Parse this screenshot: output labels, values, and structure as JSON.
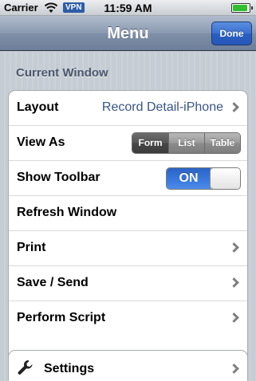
{
  "status": {
    "carrier": "Carrier",
    "vpn": "VPN",
    "time": "11:59 AM",
    "battery_level": 0.9
  },
  "nav": {
    "title": "Menu",
    "done_label": "Done"
  },
  "section": {
    "header": "Current Window"
  },
  "rows": {
    "layout": {
      "label": "Layout",
      "value": "Record Detail-iPhone"
    },
    "view_as": {
      "label": "View As",
      "options": [
        "Form",
        "List",
        "Table"
      ],
      "selected": "Form"
    },
    "show_toolbar": {
      "label": "Show Toolbar",
      "toggle": "ON"
    },
    "refresh": {
      "label": "Refresh Window"
    },
    "print": {
      "label": "Print"
    },
    "save_send": {
      "label": "Save / Send"
    },
    "perform_script": {
      "label": "Perform Script"
    }
  },
  "settings": {
    "label": "Settings",
    "icon": "wrench-icon"
  },
  "colors": {
    "accent": "#2d64c5",
    "value_text": "#385487",
    "section_header": "#4c566c"
  }
}
